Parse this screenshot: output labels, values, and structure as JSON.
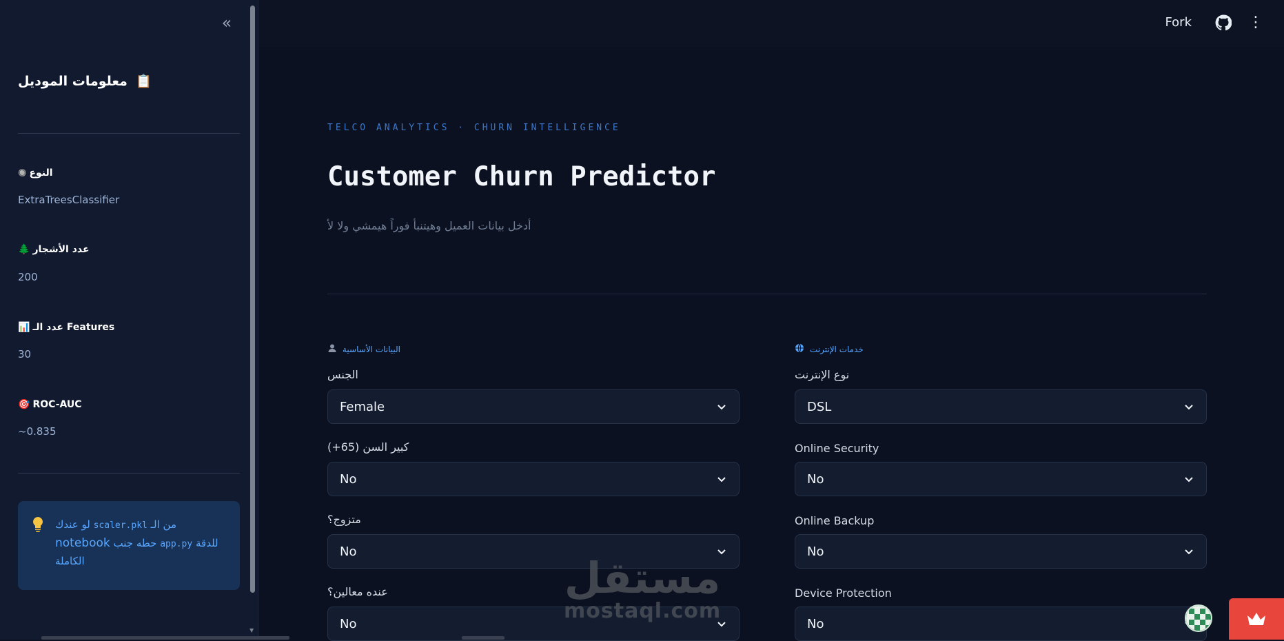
{
  "sidebar": {
    "collapse_icon": "double-chevron-left-icon",
    "title": "معلومات الموديل",
    "title_emoji": "📋",
    "metrics": [
      {
        "emoji": "🔘",
        "label": "النوع",
        "value": "ExtraTreesClassifier"
      },
      {
        "emoji": "🌲",
        "label": "عدد الأشجار",
        "value": "200"
      },
      {
        "emoji": "📊",
        "label": "عدد الـ Features",
        "value": "30"
      },
      {
        "emoji": "🎯",
        "label": "ROC-AUC",
        "value": "~0.835"
      }
    ],
    "info": {
      "icon": "lightbulb-icon",
      "line1_a": "لو عندك",
      "line1_code": "scaler.pkl",
      "line1_b": "من الـ",
      "line2_a": "notebook",
      "line2_b": "حطه جنب",
      "line2_code": "app.py",
      "line2_c": "للدقة",
      "line3": "الكاملة"
    }
  },
  "topbar": {
    "fork_label": "Fork",
    "github_icon": "github-icon",
    "menu_icon": "kebab-menu-icon"
  },
  "main": {
    "eyebrow": "TELCO ANALYTICS · CHURN INTELLIGENCE",
    "title": "Customer Churn Predictor",
    "subtitle": "أدخل بيانات العميل وهيتنبأ فوراً هيمشي ولا لأ",
    "left_section": {
      "icon": "person-icon",
      "title": "البيانات الأساسية",
      "fields": [
        {
          "label": "الجنس",
          "value": "Female"
        },
        {
          "label": "كبير السن (65+)",
          "value": "No"
        },
        {
          "label": "متزوج؟",
          "value": "No"
        },
        {
          "label": "عنده معالين؟",
          "value": "No"
        }
      ]
    },
    "right_section": {
      "icon": "globe-icon",
      "title": "خدمات الإنترنت",
      "fields": [
        {
          "label": "نوع الإنترنت",
          "value": "DSL"
        },
        {
          "label": "Online Security",
          "value": "No"
        },
        {
          "label": "Online Backup",
          "value": "No"
        },
        {
          "label": "Device Protection",
          "value": "No"
        }
      ]
    }
  },
  "watermark": {
    "arabic": "مستقل",
    "latin": "mostaql.com"
  },
  "colors": {
    "accent": "#58a6ff",
    "background": "#0b1120",
    "sidebar": "#111a2e",
    "info_box": "#173256",
    "crown_button": "#e8453c"
  }
}
